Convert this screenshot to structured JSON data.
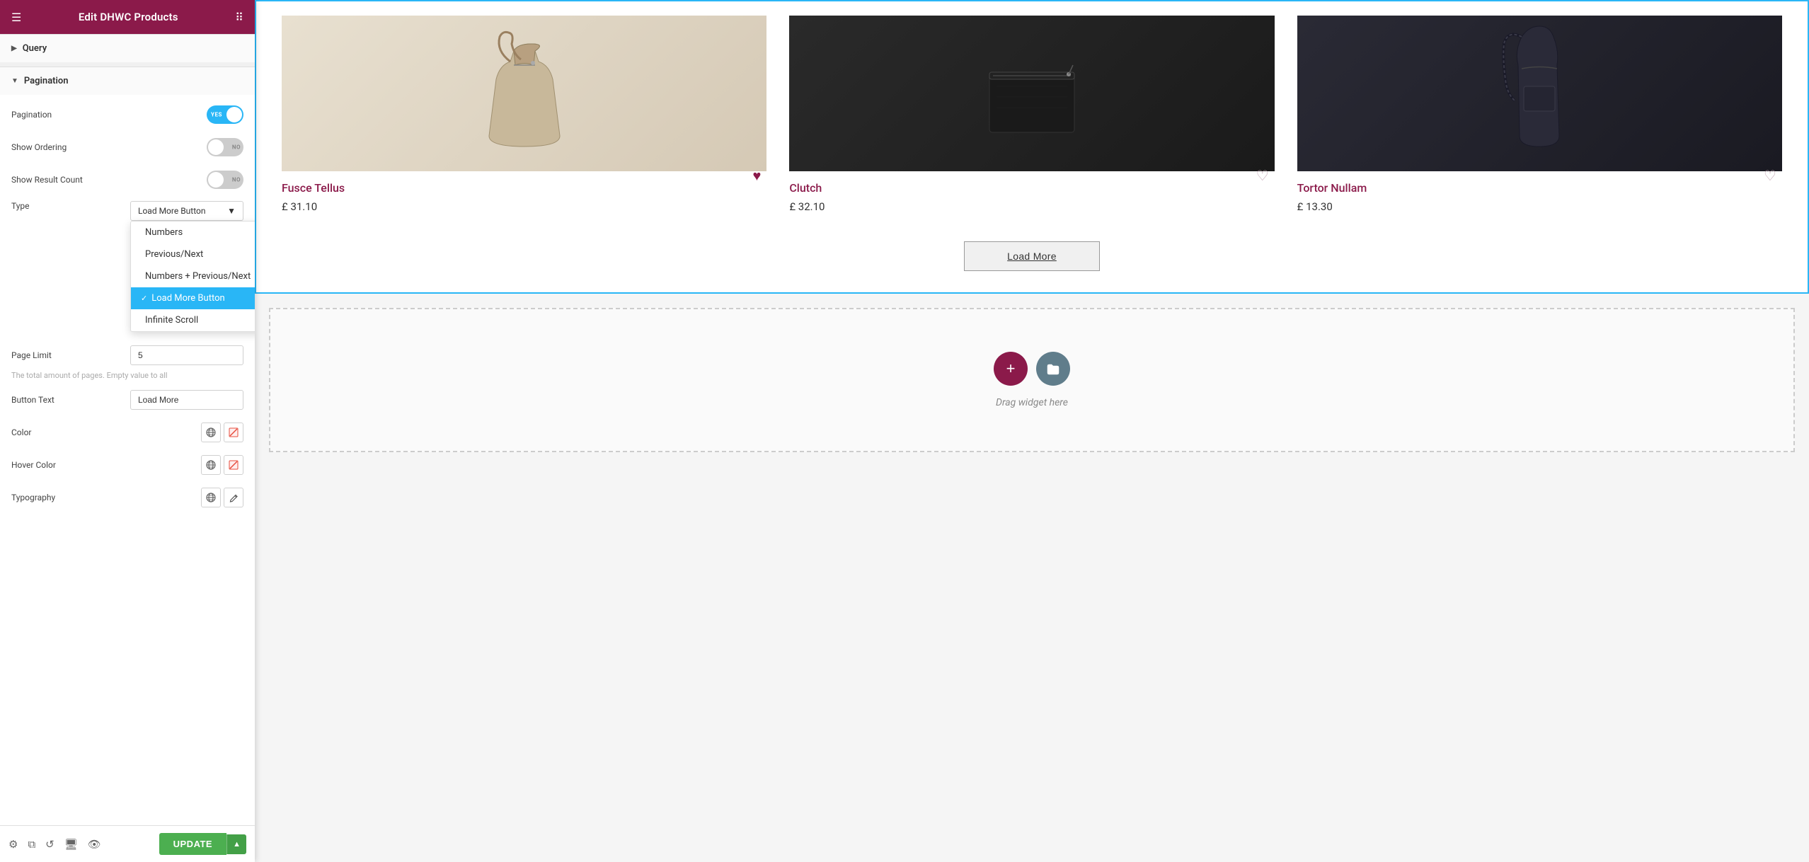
{
  "header": {
    "title": "Edit DHWC Products",
    "hamburger_icon": "☰",
    "grid_icon": "⊞"
  },
  "sections": {
    "query": {
      "label": "Query",
      "collapsed": true
    },
    "pagination": {
      "label": "Pagination",
      "collapsed": false,
      "fields": {
        "pagination": {
          "label": "Pagination",
          "type": "toggle",
          "value": true,
          "on_label": "YES",
          "off_label": "NO"
        },
        "show_ordering": {
          "label": "Show Ordering",
          "type": "toggle",
          "value": false,
          "on_label": "YES",
          "off_label": "NO"
        },
        "show_result_count": {
          "label": "Show Result Count",
          "type": "toggle",
          "value": false,
          "on_label": "YES",
          "off_label": "NO"
        },
        "type": {
          "label": "Type",
          "selected": "Load More Button",
          "options": [
            {
              "value": "numbers",
              "label": "Numbers",
              "selected": false
            },
            {
              "value": "previous_next",
              "label": "Previous/Next",
              "selected": false
            },
            {
              "value": "numbers_previous_next",
              "label": "Numbers + Previous/Next",
              "selected": false
            },
            {
              "value": "load_more_button",
              "label": "Load More Button",
              "selected": true
            },
            {
              "value": "infinite_scroll",
              "label": "Infinite Scroll",
              "selected": false
            }
          ]
        },
        "page_limit": {
          "label": "Page Limit",
          "value": "5",
          "hint": "The total amount of pages. Empty value to all"
        },
        "button_text": {
          "label": "Button Text",
          "value": "Load More"
        },
        "color": {
          "label": "Color"
        },
        "hover_color": {
          "label": "Hover Color"
        },
        "typography": {
          "label": "Typography"
        }
      }
    }
  },
  "products": [
    {
      "name": "Fusce Tellus",
      "price": "£ 31.10",
      "heart": "filled",
      "img_type": "bag1"
    },
    {
      "name": "Clutch",
      "price": "£ 32.10",
      "heart": "outline",
      "img_type": "bag2"
    },
    {
      "name": "Tortor Nullam",
      "price": "£ 13.30",
      "heart": "outline",
      "img_type": "bag3"
    }
  ],
  "load_more_button": {
    "label": "Load More"
  },
  "widget_area": {
    "drop_label": "Drag widget here"
  },
  "toolbar": {
    "update_label": "UPDATE"
  }
}
